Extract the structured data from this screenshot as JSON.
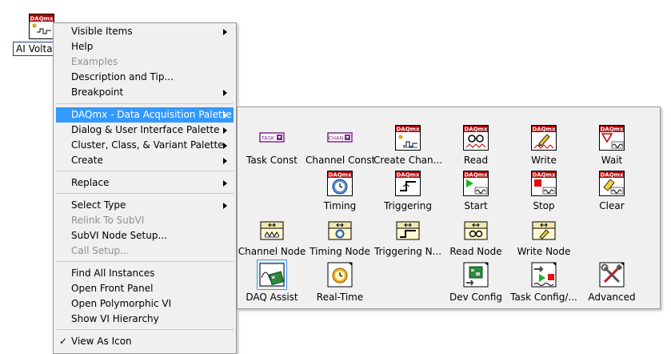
{
  "block_diagram": {
    "vi_label": "AI Voltage",
    "vi_icon_text": "DAQmx"
  },
  "context_menu": {
    "items": [
      {
        "label": "Visible Items",
        "submenu": true,
        "disabled": false
      },
      {
        "label": "Help",
        "submenu": false,
        "disabled": false
      },
      {
        "label": "Examples",
        "submenu": false,
        "disabled": true
      },
      {
        "label": "Description and Tip...",
        "submenu": false,
        "disabled": false
      },
      {
        "label": "Breakpoint",
        "submenu": true,
        "disabled": false
      },
      {
        "label": "DAQmx - Data Acquisition Palette",
        "submenu": true,
        "disabled": false,
        "active": true
      },
      {
        "label": "Dialog & User Interface Palette",
        "submenu": true,
        "disabled": false
      },
      {
        "label": "Cluster, Class, & Variant Palette",
        "submenu": true,
        "disabled": false
      },
      {
        "label": "Create",
        "submenu": true,
        "disabled": false
      },
      {
        "label": "Replace",
        "submenu": true,
        "disabled": false
      },
      {
        "label": "Select Type",
        "submenu": true,
        "disabled": false
      },
      {
        "label": "Relink To SubVI",
        "submenu": false,
        "disabled": true
      },
      {
        "label": "SubVI Node Setup...",
        "submenu": false,
        "disabled": false
      },
      {
        "label": "Call Setup...",
        "submenu": false,
        "disabled": true
      },
      {
        "label": "Find All Instances",
        "submenu": false,
        "disabled": false
      },
      {
        "label": "Open Front Panel",
        "submenu": false,
        "disabled": false
      },
      {
        "label": "Open Polymorphic VI",
        "submenu": false,
        "disabled": false
      },
      {
        "label": "Show VI Hierarchy",
        "submenu": false,
        "disabled": false
      },
      {
        "label": "View As Icon",
        "submenu": false,
        "disabled": false,
        "checked": true
      }
    ],
    "check_glyph": "✓"
  },
  "palette": {
    "icon_header": "DAQmx",
    "const_task": "TASK",
    "const_chan": "CHAN",
    "items": [
      {
        "label": "Task Const",
        "icon": "task-constant-icon"
      },
      {
        "label": "Channel Const",
        "icon": "channel-constant-icon"
      },
      {
        "label": "Create Chan...",
        "icon": "create-channel-icon"
      },
      {
        "label": "Read",
        "icon": "read-icon"
      },
      {
        "label": "Write",
        "icon": "write-icon"
      },
      {
        "label": "Wait",
        "icon": "wait-icon"
      },
      {
        "label": "Timing",
        "icon": "timing-icon"
      },
      {
        "label": "Triggering",
        "icon": "triggering-icon"
      },
      {
        "label": "Start",
        "icon": "start-icon"
      },
      {
        "label": "Stop",
        "icon": "stop-icon"
      },
      {
        "label": "Clear",
        "icon": "clear-icon"
      },
      {
        "label": "Channel Node",
        "icon": "channel-node-icon"
      },
      {
        "label": "Timing Node",
        "icon": "timing-node-icon"
      },
      {
        "label": "Triggering N...",
        "icon": "triggering-node-icon"
      },
      {
        "label": "Read Node",
        "icon": "read-node-icon"
      },
      {
        "label": "Write Node",
        "icon": "write-node-icon"
      },
      {
        "label": "DAQ Assist",
        "icon": "daq-assist-icon",
        "selected": true
      },
      {
        "label": "Real-Time",
        "icon": "real-time-icon"
      },
      {
        "label": "Dev Config",
        "icon": "device-config-icon"
      },
      {
        "label": "Task Config/...",
        "icon": "task-config-icon"
      },
      {
        "label": "Advanced",
        "icon": "advanced-tools-icon"
      }
    ]
  },
  "colors": {
    "menu_bg": "#f0f0f0",
    "highlight": "#3399ff",
    "daqmx_header": "#b00000",
    "disabled_text": "#8f8f8f"
  }
}
